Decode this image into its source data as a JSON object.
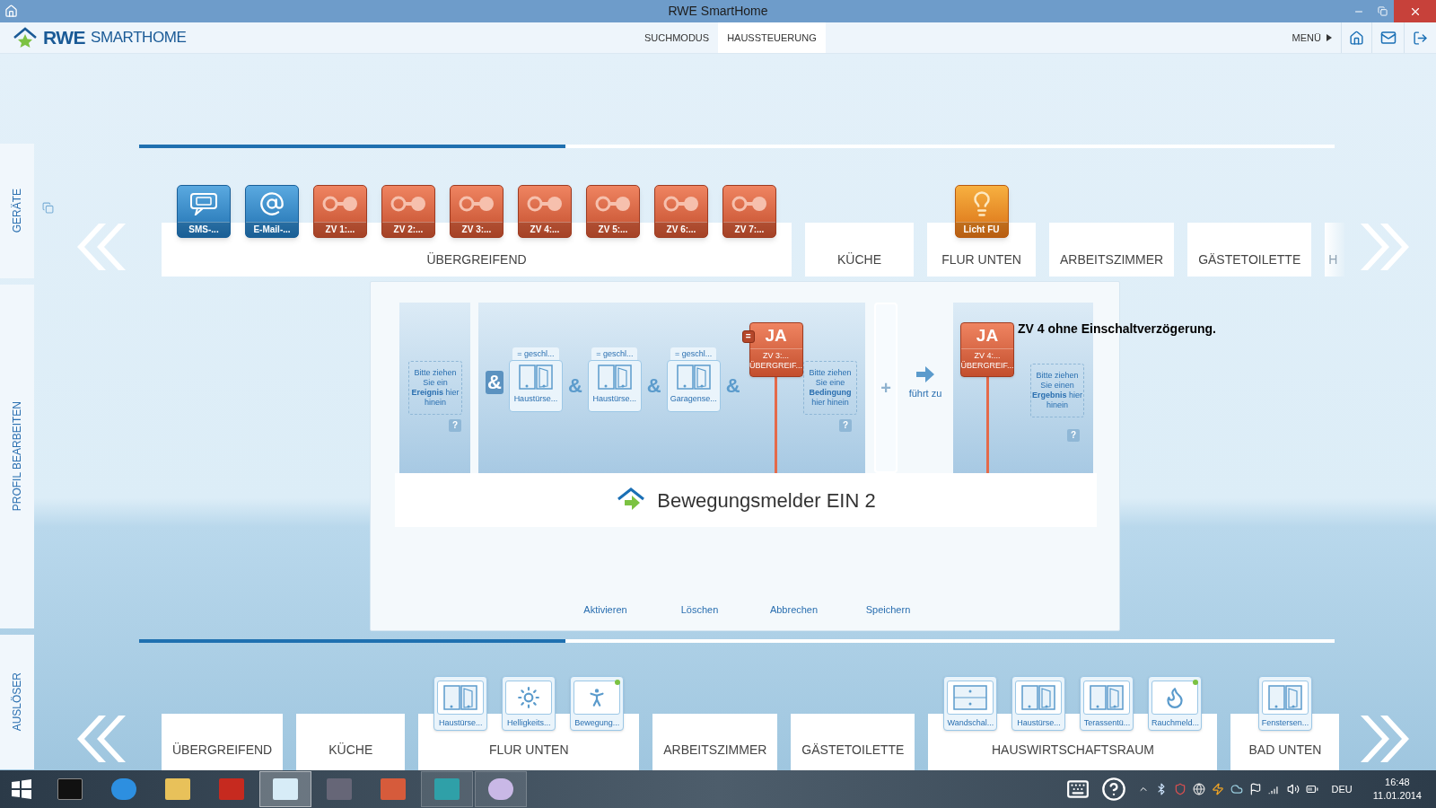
{
  "window": {
    "title": "RWE SmartHome"
  },
  "header": {
    "brand": "RWE",
    "product": "SMARTHOME",
    "modes": [
      {
        "label": "SUCHMODUS",
        "selected": false
      },
      {
        "label": "HAUSSTEUERUNG",
        "selected": true
      }
    ],
    "menu": "MENÜ"
  },
  "side_tabs": [
    {
      "label": "GERÄTE"
    },
    {
      "label": "PROFIL BEARBEITEN"
    },
    {
      "label": "AUSLÖSER"
    }
  ],
  "device_rooms": [
    {
      "name": "ÜBERGREIFEND",
      "devices": [
        {
          "label": "SMS-...",
          "kind": "sms"
        },
        {
          "label": "E-Mail-...",
          "kind": "email"
        },
        {
          "label": "ZV 1:...",
          "kind": "switch"
        },
        {
          "label": "ZV 2:...",
          "kind": "switch"
        },
        {
          "label": "ZV 3:...",
          "kind": "switch"
        },
        {
          "label": "ZV 4:...",
          "kind": "switch"
        },
        {
          "label": "ZV 5:...",
          "kind": "switch"
        },
        {
          "label": "ZV 6:...",
          "kind": "switch"
        },
        {
          "label": "ZV 7:...",
          "kind": "switch"
        }
      ]
    },
    {
      "name": "KÜCHE"
    },
    {
      "name": "FLUR UNTEN",
      "devices": [
        {
          "label": "Licht FU",
          "kind": "light"
        }
      ]
    },
    {
      "name": "ARBEITSZIMMER"
    },
    {
      "name": "GÄSTETOILETTE"
    },
    {
      "name": "H",
      "clipped": true
    }
  ],
  "rule": {
    "trigger": {
      "hint": "Bitte ziehen Sie ein **Ereignis** hier hinein",
      "help": "?"
    },
    "conditions": [
      {
        "kind": "state",
        "joiner": "&",
        "value": "= geschl...",
        "device": "Haustürse..."
      },
      {
        "kind": "state",
        "joiner": "&",
        "value": "= geschl...",
        "device": "Haustürse..."
      },
      {
        "kind": "state",
        "joiner": "&",
        "value": "= geschl...",
        "device": "Garagense..."
      },
      {
        "kind": "actuator",
        "joiner": "&",
        "badge": "=",
        "value": "JA",
        "device": "ZV 3:...",
        "room": "ÜBERGREIF..."
      }
    ],
    "condition_hint": "Bitte ziehen Sie eine **Bedingung** hier hinein",
    "condition_help": "?",
    "add": "+",
    "leads_to": "führt zu",
    "results": [
      {
        "value": "JA",
        "device": "ZV 4:...",
        "room": "ÜBERGREIF..."
      }
    ],
    "result_hint": "Bitte ziehen Sie einen **Ergebnis** hier hinein",
    "result_help": "?",
    "profile_name": "Bewegungsmelder EIN 2",
    "actions": [
      "Aktivieren",
      "Löschen",
      "Abbrechen",
      "Speichern"
    ],
    "note": "ZV 4 ohne Einschaltverzögerung."
  },
  "trigger_rooms": [
    {
      "name": "ÜBERGREIFEND"
    },
    {
      "name": "KÜCHE"
    },
    {
      "name": "FLUR UNTEN",
      "devices": [
        {
          "label": "Haustürse...",
          "kind": "door",
          "active": false
        },
        {
          "label": "Helligkeits...",
          "kind": "brightness",
          "active": false
        },
        {
          "label": "Bewegung...",
          "kind": "motion",
          "active": true
        }
      ]
    },
    {
      "name": "ARBEITSZIMMER"
    },
    {
      "name": "GÄSTETOILETTE"
    },
    {
      "name": "HAUSWIRTSCHAFTSRAUM",
      "devices": [
        {
          "label": "Wandschal...",
          "kind": "wall_switch",
          "active": false
        },
        {
          "label": "Haustürse...",
          "kind": "door",
          "active": false
        },
        {
          "label": "Terassentü...",
          "kind": "door",
          "active": false
        },
        {
          "label": "Rauchmeld...",
          "kind": "smoke",
          "active": true
        }
      ]
    },
    {
      "name": "BAD UNTEN",
      "devices": [
        {
          "label": "Fenstersen...",
          "kind": "window",
          "active": false
        }
      ]
    }
  ],
  "taskbar": {
    "language": "DEU",
    "time": "16:48",
    "date": "11.01.2014"
  }
}
